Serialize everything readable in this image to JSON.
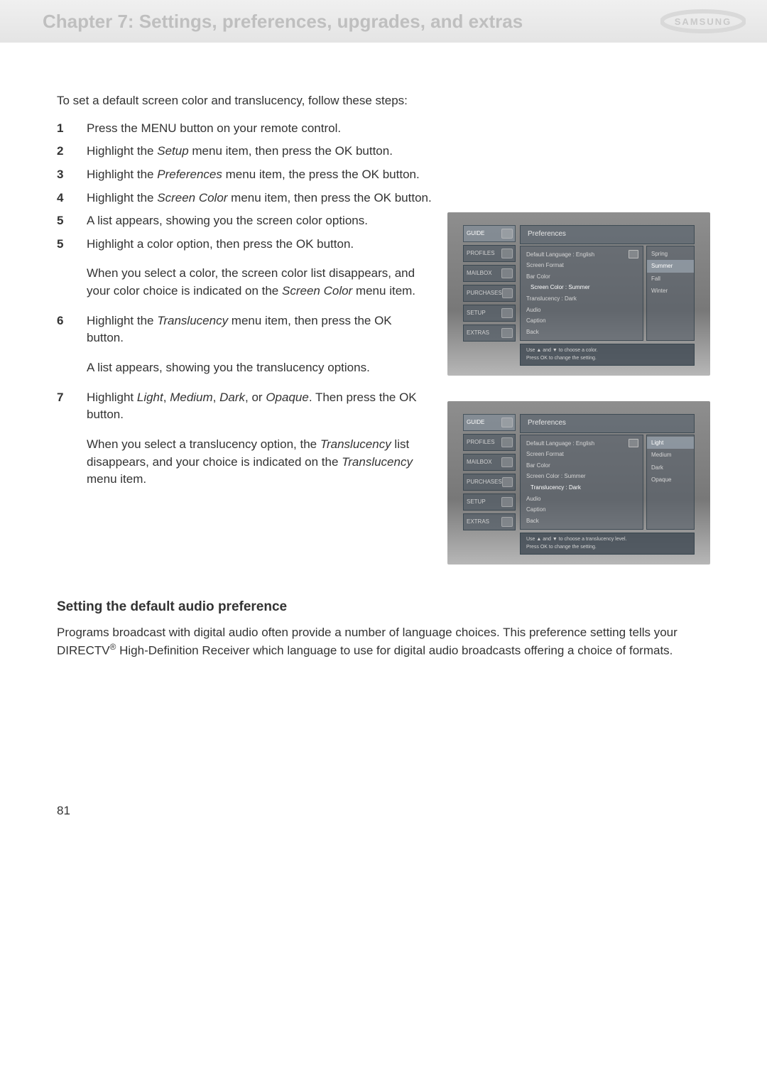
{
  "header": {
    "title": "Chapter 7: Settings, preferences, upgrades, and extras",
    "brand": "SAMSUNG"
  },
  "body": {
    "intro": "To set a default screen color and translucency, follow these steps:",
    "steps": {
      "s1": {
        "text": "Press the MENU button on your remote control."
      },
      "s2": {
        "pre": "Highlight the ",
        "i": "Setup",
        "post": " menu item, then press the OK button."
      },
      "s3": {
        "pre": "Highlight the ",
        "i": "Preferences",
        "post": " menu item, the press the OK button."
      },
      "s4": {
        "pre": "Highlight the ",
        "i": "Screen Color",
        "post": " menu item, then press the OK button."
      },
      "s4_p": "A list appears, showing you the screen color options.",
      "s5": {
        "text": "Highlight a color option, then press the OK button."
      },
      "s5_p": {
        "pre": "When you select a color, the screen color list disappears, and your color choice is indicated on the ",
        "i": "Screen Color",
        "post": " menu item."
      },
      "s6": {
        "pre": "Highlight the ",
        "i": "Translucency",
        "post": " menu item, then press the OK button."
      },
      "s6_p": "A list appears, showing you the translucency options.",
      "s7": {
        "pre": "Highlight ",
        "i1": "Light",
        "c1": ", ",
        "i2": "Medium",
        "c2": ", ",
        "i3": "Dark",
        "c3": ", or ",
        "i4": "Opaque",
        "post": ". Then press the OK button."
      },
      "s7_p": {
        "pre": "When you select a translucency option, the ",
        "i": "Translucency",
        "mid": " list disappears, and your choice is indicated on the ",
        "i2": "Translucency",
        "post": " menu item."
      }
    },
    "section_heading": "Setting the default audio preference",
    "section_body_a": "Programs broadcast with digital audio often provide a number of language choices. This preference setting tells your DIRECTV",
    "section_body_reg": "®",
    "section_body_b": " High-Definition Receiver which language to use for digital audio broadcasts offering a choice of formats.",
    "page_num": "81"
  },
  "tv1": {
    "sidebar": [
      "GUIDE",
      "PROFILES",
      "MAILBOX",
      "PURCHASES",
      "SETUP",
      "EXTRAS"
    ],
    "panel_title": "Preferences",
    "menu": {
      "lang": "Default Language : English",
      "sf": "Screen Format",
      "bc": "Bar Color",
      "sc": "Screen Color : Summer",
      "tr": "Translucency : Dark",
      "au": "Audio",
      "cap": "Caption",
      "back": "Back"
    },
    "options": [
      "Spring",
      "Summer",
      "Fall",
      "Winter"
    ],
    "hint1": "Use ▲ and ▼ to choose a color.",
    "hint2": "Press OK to change the setting."
  },
  "tv2": {
    "sidebar": [
      "GUIDE",
      "PROFILES",
      "MAILBOX",
      "PURCHASES",
      "SETUP",
      "EXTRAS"
    ],
    "panel_title": "Preferences",
    "menu": {
      "lang": "Default Language : English",
      "sf": "Screen Format",
      "bc": "Bar Color",
      "sc": "Screen Color : Summer",
      "tr": "Translucency : Dark",
      "au": "Audio",
      "cap": "Caption",
      "back": "Back"
    },
    "options": [
      "Light",
      "Medium",
      "Dark",
      "Opaque"
    ],
    "hint1": "Use ▲ and ▼ to choose a translucency level.",
    "hint2": "Press OK to change the setting."
  }
}
